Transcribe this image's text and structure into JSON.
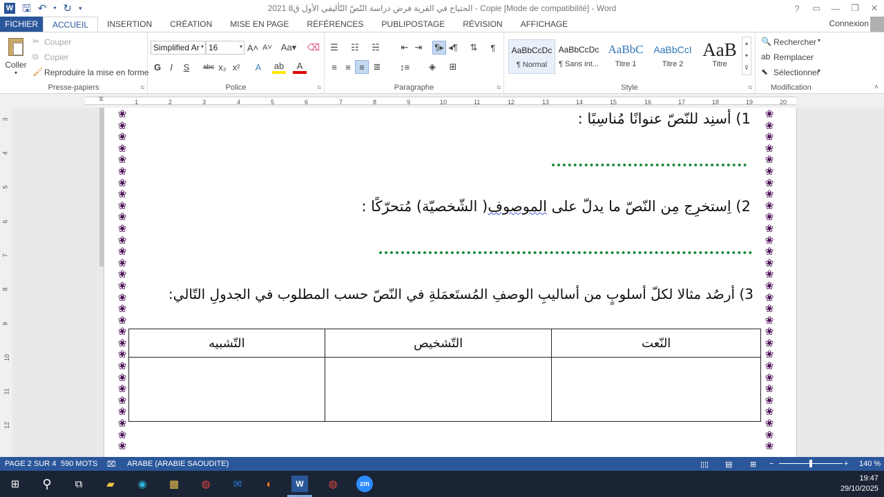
{
  "titlebar": {
    "title": "الحتياج في القرية فرض دراسة النّصّ التّأليفي الأول ق8 2021 - Copie [Mode de compatibilité] - Word",
    "help": "?",
    "controls": [
      "▭",
      "—",
      "❐",
      "✕"
    ]
  },
  "tabs": {
    "items": [
      "FICHIER",
      "ACCUEIL",
      "INSERTION",
      "CRÉATION",
      "MISE EN PAGE",
      "RÉFÉRENCES",
      "PUBLIPOSTAGE",
      "RÉVISION",
      "AFFICHAGE"
    ],
    "active": "ACCUEIL",
    "connexion": "Connexion"
  },
  "ribbon": {
    "clipboard": {
      "paste": "Coller",
      "cut": "Couper",
      "copy": "Copier",
      "format_painter": "Reproduire la mise en forme",
      "label": "Presse-papiers"
    },
    "font": {
      "name": "Simplified Ar",
      "size": "16",
      "label": "Police"
    },
    "paragraph": {
      "label": "Paragraphe"
    },
    "styles": {
      "items": [
        {
          "preview": "AaBbCcDc",
          "name": "¶ Normal"
        },
        {
          "preview": "AaBbCcDc",
          "name": "¶ Sans int..."
        },
        {
          "preview": "AaBbC",
          "name": "Titre 1"
        },
        {
          "preview": "AaBbCcI",
          "name": "Titre 2"
        },
        {
          "preview": "AaB",
          "name": "Titre"
        }
      ],
      "label": "Style"
    },
    "editing": {
      "find": "Rechercher",
      "replace": "Remplacer",
      "select": "Sélectionner",
      "label": "Modification"
    }
  },
  "ruler": {
    "h": [
      "1",
      "2",
      "3",
      "4",
      "5",
      "6",
      "7",
      "8",
      "9",
      "10",
      "11",
      "12",
      "13",
      "14",
      "15",
      "16",
      "17",
      "18",
      "19",
      "20"
    ],
    "v": [
      "3",
      "4",
      "5",
      "6",
      "7",
      "8",
      "9",
      "10",
      "11",
      "12"
    ]
  },
  "document": {
    "q1": "1) أسنِد للنّصّ عنوانًا مُناسِبًا :",
    "q2_before": "2) اِستخرِج مِن النّصّ ما يدلّ على ",
    "q2_underlined": "الموصوف",
    "q2_after": "( الشّخصيّة) مُتحرّكًا :",
    "q3": "3) أرصُد مثالا لكلّ أسلوبٍ من أساليبِ الوصفِ المُستَعمَلةِ في النّصّ حسب المطلوب في الجدولِ التّالي:",
    "table_headers": [
      "النّعت",
      "التّشخيص",
      "التّشبيه"
    ]
  },
  "statusbar": {
    "page": "PAGE 2 SUR 4",
    "words": "590 MOTS",
    "language": "ARABE (ARABIE SAOUDITE)",
    "zoom": "140 %"
  },
  "taskbar": {
    "time": "19:47",
    "date": "29/10/2025"
  }
}
